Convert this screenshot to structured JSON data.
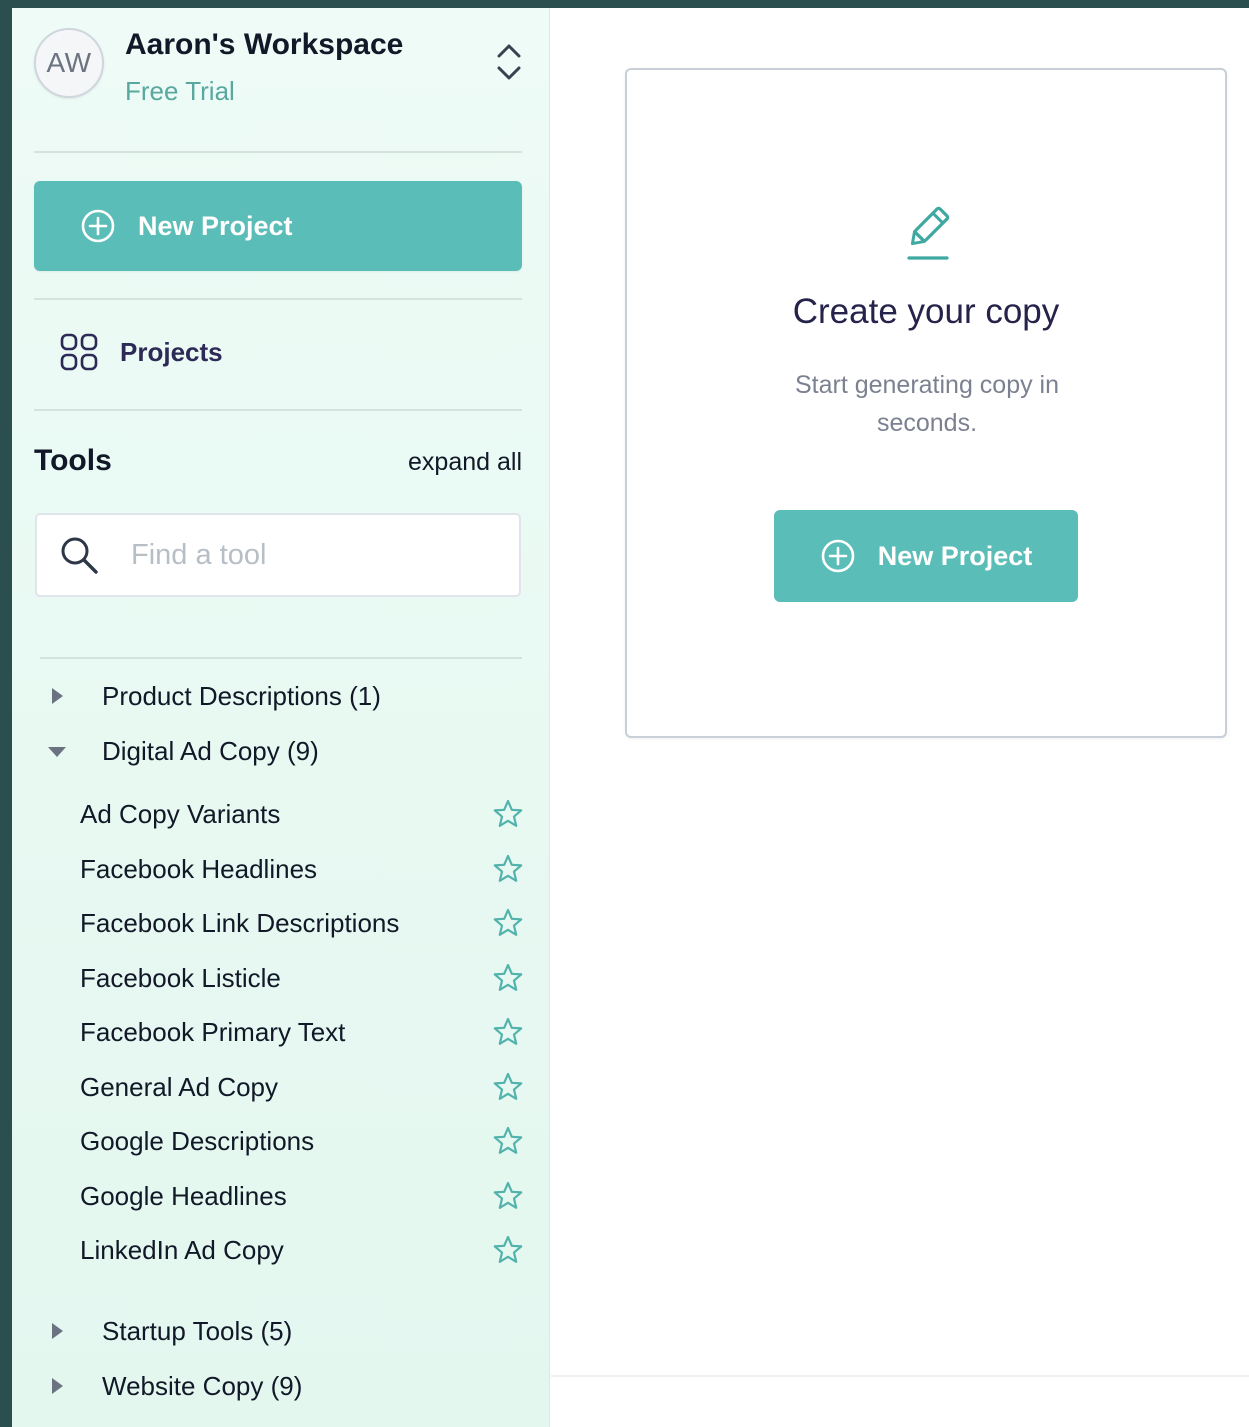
{
  "workspace": {
    "initials": "AW",
    "name": "Aaron's Workspace",
    "plan": "Free Trial"
  },
  "sidebar": {
    "new_project_label": "New Project",
    "projects_label": "Projects",
    "tools_title": "Tools",
    "expand_all": "expand all",
    "search_placeholder": "Find a tool",
    "categories": [
      {
        "name": "Product Descriptions (1)",
        "expanded": false
      },
      {
        "name": "Digital Ad Copy (9)",
        "expanded": true
      },
      {
        "name": "Startup Tools (5)",
        "expanded": false
      },
      {
        "name": "Website Copy (9)",
        "expanded": false
      }
    ],
    "tools": [
      "Ad Copy Variants",
      "Facebook Headlines",
      "Facebook Link Descriptions",
      "Facebook Listicle",
      "Facebook Primary Text",
      "General Ad Copy",
      "Google Descriptions",
      "Google Headlines",
      "LinkedIn Ad Copy"
    ]
  },
  "main": {
    "card_title": "Create your copy",
    "card_subtitle": "Start generating copy in seconds.",
    "card_button_label": "New Project"
  },
  "colors": {
    "accent": "#5bbdb8",
    "sidebar_bg": "#e3f7ef",
    "title": "#26234a",
    "frame": "#2b4f4f"
  },
  "icons": {
    "toggle": "chevron-up-down-icon",
    "add": "plus-circle-icon",
    "projects": "grid-icon",
    "search": "search-icon",
    "caret_right": "caret-right-icon",
    "caret_down": "caret-down-icon",
    "favorite": "star-outline-icon",
    "pencil": "pencil-icon"
  }
}
